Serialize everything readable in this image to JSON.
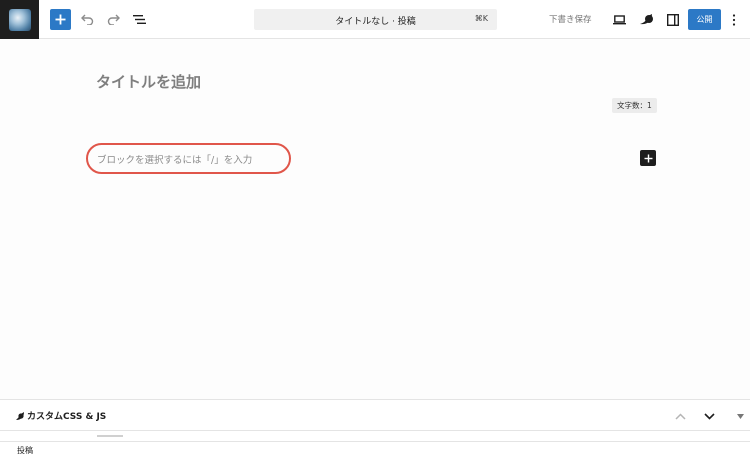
{
  "toolbar": {
    "add_block_icon": "plus-icon",
    "undo_icon": "undo-icon",
    "redo_icon": "redo-icon",
    "list_view_icon": "list-view-icon",
    "command_title": "タイトルなし · 投稿",
    "command_shortcut": "⌘K",
    "save_draft_label": "下書き保存",
    "preview_icon": "laptop-icon",
    "styles_icon": "half-circle-icon",
    "settings_icon": "sidebar-icon",
    "publish_label": "公開",
    "options_icon": "vertical-ellipsis-icon"
  },
  "editor": {
    "title_placeholder": "タイトルを追加",
    "char_count": "文字数：1",
    "block_placeholder": "ブロックを選択するには「/」を入力",
    "inserter_icon": "plus-icon"
  },
  "meta_box": {
    "title": "カスタムCSS & JS",
    "icon": "leaf-icon",
    "move_up_icon": "chevron-up-icon",
    "move_down_icon": "chevron-down-icon",
    "toggle_icon": "caret-down-icon"
  },
  "footer": {
    "breadcrumb": "投稿"
  },
  "colors": {
    "accent": "#2c79c6",
    "highlight_ring": "#e0564a",
    "dark": "#1e1e1e"
  }
}
